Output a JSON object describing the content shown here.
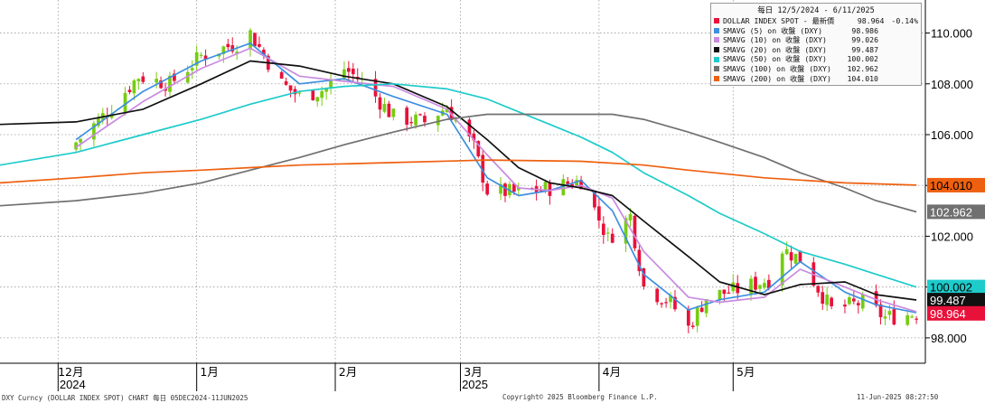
{
  "chart_data": {
    "type": "candlestick",
    "title": "DOLLAR INDEX SPOT",
    "legend_header": "每日 12/5/2024 - 6/11/2025",
    "y_ticks": [
      "110.000",
      "108.000",
      "106.000",
      "104.000",
      "102.000",
      "100.000",
      "98.000"
    ],
    "ylim": [
      97.0,
      111.3
    ],
    "grid": true,
    "legend_position": "top-right",
    "x_months": [
      {
        "label": "12月",
        "year": "2024",
        "date": "2024-12-01"
      },
      {
        "label": "1月",
        "year": "",
        "date": "2025-01-01"
      },
      {
        "label": "2月",
        "year": "",
        "date": "2025-02-01"
      },
      {
        "label": "3月",
        "year": "2025",
        "date": "2025-03-01"
      },
      {
        "label": "4月",
        "year": "",
        "date": "2025-04-01"
      },
      {
        "label": "5月",
        "year": "",
        "date": "2025-05-01"
      }
    ],
    "x_range": [
      "2024-11-18",
      "2025-06-13"
    ],
    "colors": {
      "up": "#77cc11",
      "down": "#e8113a"
    },
    "legend": [
      {
        "name": "DOLLAR INDEX SPOT - 最新價",
        "value": "98.964",
        "change": "-0.14%",
        "color": "#e8113a"
      },
      {
        "name": "SMAVG (5)  on 收盤 (DXY)",
        "value": "98.986",
        "color": "#3d8fe0"
      },
      {
        "name": "SMAVG (10)  on 收盤 (DXY)",
        "value": "99.026",
        "color": "#c98ae0"
      },
      {
        "name": "SMAVG (20)  on 收盤 (DXY)",
        "value": "99.487",
        "color": "#111111"
      },
      {
        "name": "SMAVG (50)  on 收盤 (DXY)",
        "value": "100.002",
        "color": "#1ecbcb"
      },
      {
        "name": "SMAVG (100)  on 收盤 (DXY)",
        "value": "102.962",
        "color": "#707070"
      },
      {
        "name": "SMAVG (200)  on 收盤 (DXY)",
        "value": "104.010",
        "color": "#ee6010"
      }
    ],
    "price_tags": [
      {
        "value": 104.01,
        "label": "104.010",
        "bg": "#ee6010",
        "fg": "#000000"
      },
      {
        "value": 102.962,
        "label": "102.962",
        "bg": "#707070",
        "fg": "#ffffff"
      },
      {
        "value": 100.002,
        "label": "100.002",
        "bg": "#1ecbcb",
        "fg": "#000000"
      },
      {
        "value": 99.487,
        "label": "99.487",
        "bg": "#111111",
        "fg": "#ffffff"
      },
      {
        "value": 98.964,
        "label": "98.964",
        "bg": "#e8113a",
        "fg": "#ffffff"
      }
    ],
    "candle_anchors": [
      {
        "date": "2024-12-05",
        "close": 105.7
      },
      {
        "date": "2024-12-12",
        "close": 106.9
      },
      {
        "date": "2024-12-19",
        "close": 108.3
      },
      {
        "date": "2024-12-26",
        "close": 108.0
      },
      {
        "date": "2025-01-02",
        "close": 109.1
      },
      {
        "date": "2025-01-10",
        "close": 109.6
      },
      {
        "date": "2025-01-13",
        "close": 110.0
      },
      {
        "date": "2025-01-20",
        "close": 108.0
      },
      {
        "date": "2025-01-24",
        "close": 107.5
      },
      {
        "date": "2025-01-30",
        "close": 107.8
      },
      {
        "date": "2025-02-03",
        "close": 108.6
      },
      {
        "date": "2025-02-07",
        "close": 108.1
      },
      {
        "date": "2025-02-14",
        "close": 106.7
      },
      {
        "date": "2025-02-21",
        "close": 106.5
      },
      {
        "date": "2025-02-26",
        "close": 107.1
      },
      {
        "date": "2025-03-04",
        "close": 105.5
      },
      {
        "date": "2025-03-07",
        "close": 103.8
      },
      {
        "date": "2025-03-14",
        "close": 103.7
      },
      {
        "date": "2025-03-21",
        "close": 103.9
      },
      {
        "date": "2025-03-28",
        "close": 104.2
      },
      {
        "date": "2025-04-03",
        "close": 101.9
      },
      {
        "date": "2025-04-08",
        "close": 102.8
      },
      {
        "date": "2025-04-11",
        "close": 100.0
      },
      {
        "date": "2025-04-17",
        "close": 99.4
      },
      {
        "date": "2025-04-21",
        "close": 98.4
      },
      {
        "date": "2025-04-25",
        "close": 99.6
      },
      {
        "date": "2025-05-02",
        "close": 99.9
      },
      {
        "date": "2025-05-09",
        "close": 100.3
      },
      {
        "date": "2025-05-12",
        "close": 101.5
      },
      {
        "date": "2025-05-16",
        "close": 101.1
      },
      {
        "date": "2025-05-23",
        "close": 99.1
      },
      {
        "date": "2025-05-30",
        "close": 99.4
      },
      {
        "date": "2025-06-04",
        "close": 98.8
      },
      {
        "date": "2025-06-11",
        "close": 98.96
      }
    ],
    "ma_series": [
      {
        "period": 5,
        "color": "#3d8fe0",
        "points": [
          [
            "2024-12-05",
            105.8
          ],
          [
            "2024-12-20",
            107.7
          ],
          [
            "2025-01-02",
            108.9
          ],
          [
            "2025-01-13",
            109.6
          ],
          [
            "2025-01-24",
            108.0
          ],
          [
            "2025-02-03",
            108.2
          ],
          [
            "2025-02-14",
            107.5
          ],
          [
            "2025-02-26",
            106.8
          ],
          [
            "2025-03-07",
            104.3
          ],
          [
            "2025-03-14",
            103.6
          ],
          [
            "2025-03-21",
            103.8
          ],
          [
            "2025-03-28",
            104.2
          ],
          [
            "2025-04-04",
            103.0
          ],
          [
            "2025-04-11",
            100.5
          ],
          [
            "2025-04-21",
            99.1
          ],
          [
            "2025-04-28",
            99.5
          ],
          [
            "2025-05-08",
            99.8
          ],
          [
            "2025-05-16",
            101.0
          ],
          [
            "2025-05-26",
            99.8
          ],
          [
            "2025-06-02",
            99.3
          ],
          [
            "2025-06-11",
            98.99
          ]
        ]
      },
      {
        "period": 10,
        "color": "#c98ae0",
        "points": [
          [
            "2024-12-05",
            105.5
          ],
          [
            "2024-12-20",
            107.3
          ],
          [
            "2025-01-02",
            108.6
          ],
          [
            "2025-01-13",
            109.4
          ],
          [
            "2025-01-24",
            108.3
          ],
          [
            "2025-02-03",
            108.1
          ],
          [
            "2025-02-14",
            107.9
          ],
          [
            "2025-02-26",
            107.0
          ],
          [
            "2025-03-07",
            105.2
          ],
          [
            "2025-03-14",
            103.9
          ],
          [
            "2025-03-21",
            103.8
          ],
          [
            "2025-03-28",
            104.0
          ],
          [
            "2025-04-04",
            103.5
          ],
          [
            "2025-04-11",
            101.4
          ],
          [
            "2025-04-21",
            99.6
          ],
          [
            "2025-04-28",
            99.4
          ],
          [
            "2025-05-08",
            99.6
          ],
          [
            "2025-05-16",
            100.7
          ],
          [
            "2025-05-26",
            100.0
          ],
          [
            "2025-06-02",
            99.5
          ],
          [
            "2025-06-11",
            99.03
          ]
        ]
      },
      {
        "period": 20,
        "color": "#111111",
        "points": [
          [
            "2024-11-18",
            106.4
          ],
          [
            "2024-12-05",
            106.5
          ],
          [
            "2024-12-20",
            107.0
          ],
          [
            "2025-01-02",
            108.0
          ],
          [
            "2025-01-13",
            108.9
          ],
          [
            "2025-01-24",
            108.7
          ],
          [
            "2025-02-03",
            108.3
          ],
          [
            "2025-02-14",
            108.0
          ],
          [
            "2025-02-26",
            107.1
          ],
          [
            "2025-03-07",
            105.8
          ],
          [
            "2025-03-14",
            104.7
          ],
          [
            "2025-03-21",
            104.1
          ],
          [
            "2025-03-28",
            103.9
          ],
          [
            "2025-04-04",
            103.6
          ],
          [
            "2025-04-11",
            102.6
          ],
          [
            "2025-04-21",
            101.2
          ],
          [
            "2025-04-28",
            100.2
          ],
          [
            "2025-05-08",
            99.7
          ],
          [
            "2025-05-16",
            100.1
          ],
          [
            "2025-05-26",
            100.2
          ],
          [
            "2025-06-02",
            99.7
          ],
          [
            "2025-06-11",
            99.49
          ]
        ]
      },
      {
        "period": 50,
        "color": "#1ecbcb",
        "points": [
          [
            "2024-11-18",
            104.8
          ],
          [
            "2024-12-05",
            105.3
          ],
          [
            "2024-12-20",
            106.0
          ],
          [
            "2025-01-02",
            106.6
          ],
          [
            "2025-01-13",
            107.2
          ],
          [
            "2025-01-24",
            107.7
          ],
          [
            "2025-02-03",
            107.9
          ],
          [
            "2025-02-14",
            108.0
          ],
          [
            "2025-02-26",
            107.8
          ],
          [
            "2025-03-07",
            107.4
          ],
          [
            "2025-03-14",
            106.9
          ],
          [
            "2025-03-21",
            106.4
          ],
          [
            "2025-03-28",
            105.9
          ],
          [
            "2025-04-04",
            105.3
          ],
          [
            "2025-04-11",
            104.5
          ],
          [
            "2025-04-21",
            103.6
          ],
          [
            "2025-04-28",
            102.9
          ],
          [
            "2025-05-08",
            102.1
          ],
          [
            "2025-05-16",
            101.4
          ],
          [
            "2025-05-26",
            100.9
          ],
          [
            "2025-06-02",
            100.5
          ],
          [
            "2025-06-11",
            100.0
          ]
        ]
      },
      {
        "period": 100,
        "color": "#707070",
        "points": [
          [
            "2024-11-18",
            103.2
          ],
          [
            "2024-12-05",
            103.4
          ],
          [
            "2024-12-20",
            103.7
          ],
          [
            "2025-01-02",
            104.1
          ],
          [
            "2025-01-13",
            104.6
          ],
          [
            "2025-01-24",
            105.1
          ],
          [
            "2025-02-03",
            105.6
          ],
          [
            "2025-02-14",
            106.1
          ],
          [
            "2025-02-26",
            106.6
          ],
          [
            "2025-03-07",
            106.8
          ],
          [
            "2025-03-21",
            106.8
          ],
          [
            "2025-04-04",
            106.8
          ],
          [
            "2025-04-11",
            106.6
          ],
          [
            "2025-04-21",
            106.1
          ],
          [
            "2025-04-28",
            105.7
          ],
          [
            "2025-05-08",
            105.1
          ],
          [
            "2025-05-16",
            104.5
          ],
          [
            "2025-05-26",
            103.9
          ],
          [
            "2025-06-02",
            103.4
          ],
          [
            "2025-06-11",
            102.96
          ]
        ]
      },
      {
        "period": 200,
        "color": "#ee6010",
        "points": [
          [
            "2024-11-18",
            104.1
          ],
          [
            "2024-12-05",
            104.3
          ],
          [
            "2024-12-20",
            104.5
          ],
          [
            "2025-01-02",
            104.6
          ],
          [
            "2025-01-13",
            104.7
          ],
          [
            "2025-01-24",
            104.8
          ],
          [
            "2025-02-14",
            104.9
          ],
          [
            "2025-03-07",
            105.0
          ],
          [
            "2025-03-28",
            104.95
          ],
          [
            "2025-04-11",
            104.8
          ],
          [
            "2025-04-21",
            104.6
          ],
          [
            "2025-05-08",
            104.3
          ],
          [
            "2025-05-26",
            104.1
          ],
          [
            "2025-06-11",
            104.01
          ]
        ]
      }
    ]
  },
  "footer": {
    "left": "DXY Curncy (DOLLAR INDEX SPOT) CHART  每日 05DEC2024-11JUN2025",
    "center": "Copyright© 2025 Bloomberg Finance L.P.",
    "right": "11-Jun-2025 08:27:50"
  }
}
